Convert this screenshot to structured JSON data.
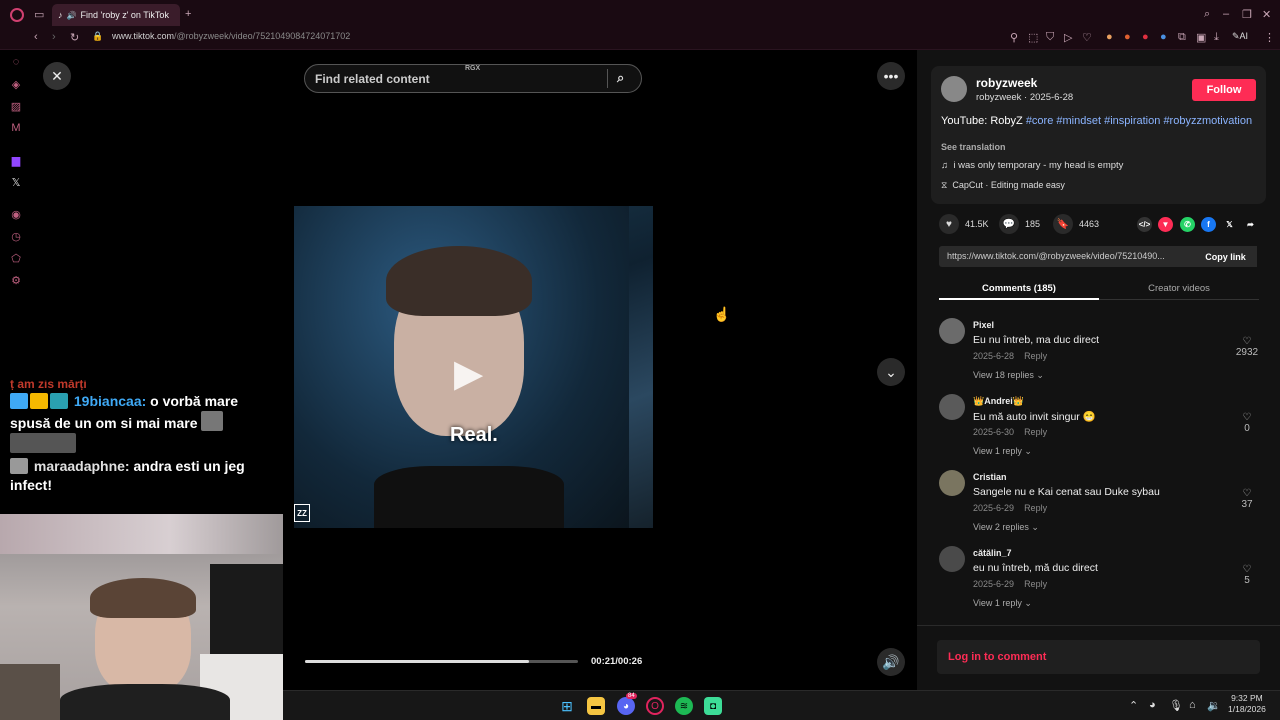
{
  "browser": {
    "tab_title": "Find 'roby z' on TikTok",
    "url_host": "www.tiktok.com",
    "url_path": "/@robyzweek/video/7521049084724071702"
  },
  "stream_chat": {
    "partial_line": "ț am zis mărți",
    "messages": [
      {
        "user": "19biancaa:",
        "text": "o vorbă mare spusă de un om si mai mare"
      },
      {
        "user": "maraadaphne:",
        "text": "andra esti un jeg infect!"
      }
    ]
  },
  "video": {
    "search_placeholder": "Find related content",
    "search_badge": "RGX",
    "caption": "Real.",
    "watermark": "ZZ",
    "time": "00:21/00:26",
    "progress": 0.82
  },
  "author": {
    "handle": "robyzweek",
    "subline": "robyzweek · 2025-6-28",
    "follow_label": "Follow",
    "description_prefix": "YouTube: RobyZ",
    "hashtags": [
      "#core",
      "#mindset",
      "#inspiration",
      "#robyzzmotivation"
    ],
    "see_translation": "See translation",
    "music": "i was only temporary - my head is empty",
    "capcut": "CapCut · Editing made easy"
  },
  "stats": {
    "likes": "41.5K",
    "comments": "185",
    "saves": "4463"
  },
  "share": {
    "link": "https://www.tiktok.com/@robyzweek/video/75210490...",
    "copy_label": "Copy link"
  },
  "tabs": {
    "comments": "Comments (185)",
    "creator": "Creator videos"
  },
  "comments": [
    {
      "name": "Pixel",
      "text": "Eu nu întreb, ma duc direct",
      "date": "2025-6-28",
      "reply": "Reply",
      "replies": "View 18 replies",
      "likes": "2932",
      "avatar_color": "#6b6b6b"
    },
    {
      "name": "👑Andrei👑",
      "text": "Eu mă auto invit singur 😁",
      "date": "2025-6-30",
      "reply": "Reply",
      "replies": "View 1 reply",
      "likes": "0",
      "avatar_color": "#5a5a5a"
    },
    {
      "name": "Cristian",
      "text": "Sangele nu e Kai cenat sau Duke sybau",
      "date": "2025-6-29",
      "reply": "Reply",
      "replies": "View 2 replies",
      "likes": "37",
      "avatar_color": "#7a7560"
    },
    {
      "name": "cătălin_7",
      "text": "eu nu întreb, mă duc direct",
      "date": "2025-6-29",
      "reply": "Reply",
      "replies": "View 1 reply",
      "likes": "5",
      "avatar_color": "#4a4a4a"
    }
  ],
  "login_label": "Log in to comment",
  "taskbar": {
    "discord_badge": "84",
    "time": "9:32 PM",
    "date": "1/18/2026"
  },
  "colors": {
    "accent": "#fe2c55",
    "hashtag": "#8bb4ff",
    "chat_user": "#3fa9f5"
  }
}
